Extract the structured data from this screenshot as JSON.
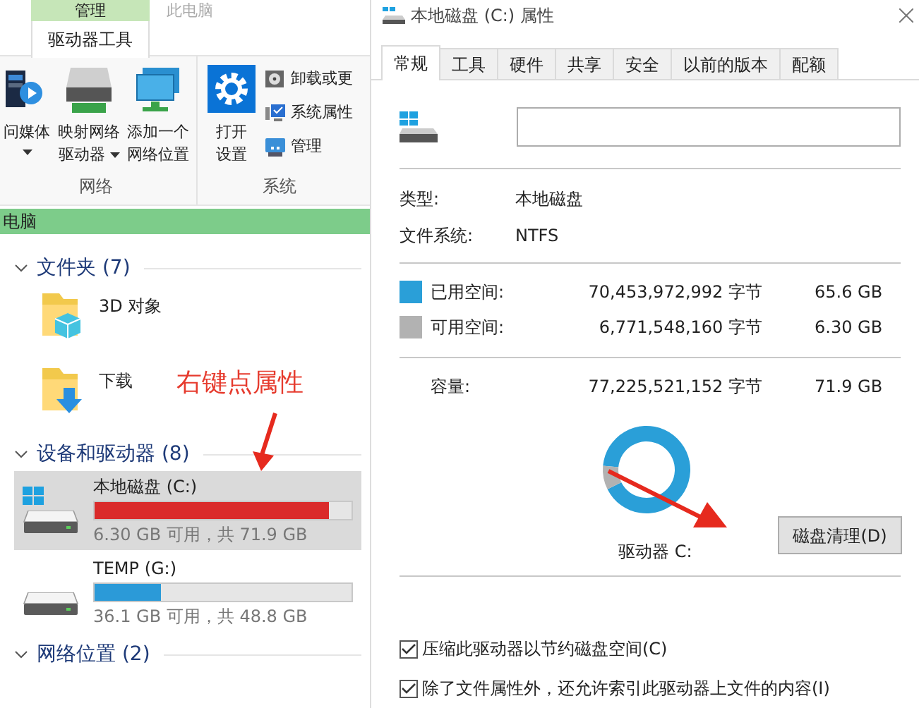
{
  "ribbon": {
    "context_tab": "管理",
    "title_tab": "此电脑",
    "tab": "驱动器工具",
    "groups": [
      {
        "label": "网络",
        "buttons": [
          {
            "kind": "media",
            "lines": [
              "问媒体"
            ],
            "dropdown": true
          },
          {
            "kind": "map",
            "lines": [
              "映射网络",
              "驱动器"
            ],
            "dropdown": true
          },
          {
            "kind": "netloc",
            "lines": [
              "添加一个",
              "网络位置"
            ],
            "dropdown": false
          }
        ]
      },
      {
        "label": "系统",
        "buttons": [
          {
            "kind": "settings",
            "lines": [
              "打开",
              "设置"
            ],
            "dropdown": false
          }
        ],
        "small": [
          {
            "kind": "uninstall",
            "label": "卸载或更"
          },
          {
            "kind": "sysprop",
            "label": "系统属性"
          },
          {
            "kind": "manage",
            "label": "管理"
          }
        ]
      }
    ]
  },
  "address_bar": "电脑",
  "sections": [
    {
      "title": "文件夹 (7)",
      "items": [
        {
          "kind": "folder3d",
          "name": "3D 对象"
        },
        {
          "kind": "download",
          "name": "下载"
        }
      ]
    },
    {
      "title": "设备和驱动器 (8)",
      "items": [
        {
          "kind": "drive",
          "name": "本地磁盘 (C:)",
          "selected": true,
          "system": true,
          "level": 0.91,
          "color": "#da2a2a",
          "free": "6.30 GB 可用，共 71.9 GB"
        },
        {
          "kind": "drive",
          "name": "TEMP (G:)",
          "selected": false,
          "system": false,
          "level": 0.26,
          "color": "#2b9ad8",
          "free": "36.1 GB 可用，共 48.8 GB"
        }
      ]
    },
    {
      "title": "网络位置 (2)"
    }
  ],
  "annotation": "右键点属性",
  "dialog": {
    "title": "本地磁盘 (C:) 属性",
    "tabs": [
      {
        "label": "常规",
        "selected": true
      },
      {
        "label": "工具",
        "selected": false
      },
      {
        "label": "硬件",
        "selected": false
      },
      {
        "label": "共享",
        "selected": false
      },
      {
        "label": "安全",
        "selected": false
      },
      {
        "label": "以前的版本",
        "selected": false
      },
      {
        "label": "配额",
        "selected": false
      }
    ],
    "info": [
      {
        "label": "类型:",
        "value": "本地磁盘"
      },
      {
        "label": "文件系统:",
        "value": "NTFS"
      }
    ],
    "space": [
      {
        "label": "已用空间:",
        "bytes": "70,453,972,992 字节",
        "size": "65.6 GB",
        "color": "#2a9fd8"
      },
      {
        "label": "可用空间:",
        "bytes": "6,771,548,160 字节",
        "size": "6.30 GB",
        "color": "#b2b2b2"
      }
    ],
    "capacity": {
      "label": "容量:",
      "bytes": "77,225,521,152 字节",
      "size": "71.9 GB"
    },
    "chart_data": {
      "type": "donut",
      "values": [
        91.2,
        8.8
      ]
    },
    "drive_label": "驱动器 C:",
    "cleanup_button": "磁盘清理(D)",
    "options": [
      {
        "label": "压缩此驱动器以节约磁盘空间(C)",
        "checked": true
      },
      {
        "label": "除了文件属性外，还允许索引此驱动器上文件的内容(I)",
        "checked": true
      }
    ]
  }
}
